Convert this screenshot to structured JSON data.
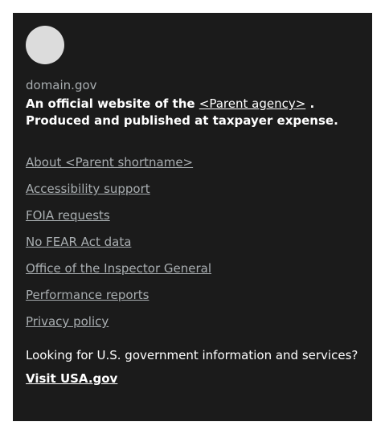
{
  "identifier": {
    "domain": "domain.gov",
    "disclaimer_prefix": "An official website of the",
    "parent_agency_link": "<Parent agency>",
    "disclaimer_suffix": ". Produced and published at taxpayer expense."
  },
  "required_links": [
    {
      "label": "About <Parent shortname>"
    },
    {
      "label": "Accessibility support"
    },
    {
      "label": "FOIA requests"
    },
    {
      "label": "No FEAR Act data"
    },
    {
      "label": "Office of the Inspector General"
    },
    {
      "label": "Performance reports"
    },
    {
      "label": "Privacy policy"
    }
  ],
  "usagov": {
    "text": "Looking for U.S. government information and services?",
    "link_label": "Visit USA.gov"
  },
  "colors": {
    "background": "#1b1b1b",
    "muted_text": "#a9aeb1",
    "text": "#ffffff",
    "logo_placeholder": "#dcdcdc"
  },
  "icons": {
    "logo": "agency-logo-placeholder"
  }
}
